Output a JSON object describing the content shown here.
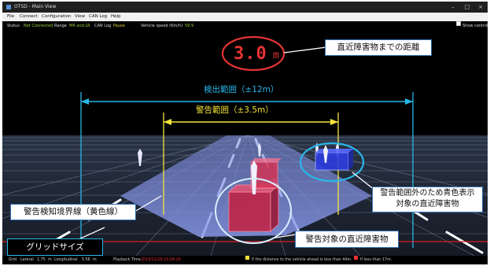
{
  "window": {
    "title": "OTSD - Main View",
    "controls": {
      "minimize": "–",
      "maximize": "□",
      "close": "×"
    }
  },
  "menu": {
    "items": [
      "File",
      "Connect",
      "Configuration",
      "View",
      "CAN Log",
      "Help"
    ]
  },
  "status": {
    "status_label": "Status",
    "status_value": "Not Connected",
    "range_label": "Range",
    "range_value": "MR and LR",
    "canlog_label": "CAN Log",
    "canlog_value": "Pause",
    "speed_label": "Vehicle speed (Km/h)",
    "speed_value": "59.9",
    "show_control": "Show control"
  },
  "display": {
    "distance_value": "3.0",
    "distance_unit": "m"
  },
  "annotations": {
    "distance": "直近障害物までの距離",
    "detection_range": "検出範囲（±12m）",
    "warning_range": "警告範囲（±3.5m）",
    "blue_obstacle_line1": "警告範囲外のため青色表示",
    "blue_obstacle_line2": "対象の直近障害物",
    "boundary": "警告検知境界線（黄色線）",
    "warning_obstacle": "警告対象の直近障害物",
    "grid_size": "グリッドサイズ"
  },
  "bottom": {
    "grid_label": "Grid",
    "lateral_label": "Lateral",
    "lateral_value": "1.75",
    "lateral_unit": "m",
    "longitudinal_label": "Longitudinal",
    "longitudinal_value": "5.56",
    "longitudinal_unit": "m",
    "playback_label": "Playback Time",
    "playback_value": "2019/11/26 15:04:20",
    "legend_yellow": "If the distance to the vehicle ahead is less than 44m.",
    "legend_red": "If less than 17m."
  },
  "colors": {
    "accent_blue": "#2f6fb5",
    "range_cyan": "#29b6e8",
    "warn_yellow": "#f5e33a",
    "alert_red": "#e53434",
    "obstacle_blue": "#2c3de0"
  }
}
